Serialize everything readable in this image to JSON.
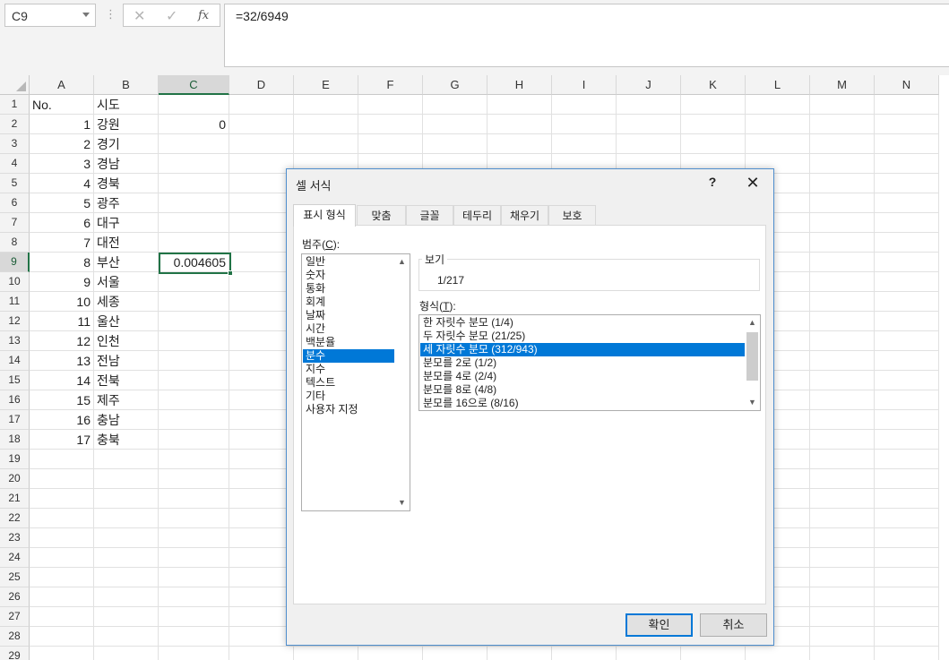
{
  "formula_bar": {
    "name_box": "C9",
    "formula": "=32/6949",
    "cancel_icon": "x-icon",
    "enter_icon": "check-icon",
    "function_icon": "fx-icon",
    "fx_label": "fx"
  },
  "columns": [
    "A",
    "B",
    "C",
    "D",
    "E",
    "F",
    "G",
    "H",
    "I",
    "J",
    "K",
    "L",
    "M",
    "N"
  ],
  "selected_column": "C",
  "rows": [
    "1",
    "2",
    "3",
    "4",
    "5",
    "6",
    "7",
    "8",
    "9",
    "10",
    "11",
    "12",
    "13",
    "14",
    "15",
    "16",
    "17",
    "18",
    "19",
    "20",
    "21",
    "22",
    "23",
    "24",
    "25",
    "26",
    "27",
    "28",
    "29"
  ],
  "selected_row": "9",
  "cells": {
    "A1": "No.",
    "B1": "시도",
    "A2": "1",
    "B2": "강원",
    "C2": "0",
    "A3": "2",
    "B3": "경기",
    "A4": "3",
    "B4": "경남",
    "A5": "4",
    "B5": "경북",
    "A6": "5",
    "B6": "광주",
    "A7": "6",
    "B7": "대구",
    "A8": "7",
    "B8": "대전",
    "A9": "8",
    "B9": "부산",
    "C9": "0.004605",
    "A10": "9",
    "B10": "서울",
    "A11": "10",
    "B11": "세종",
    "A12": "11",
    "B12": "울산",
    "A13": "12",
    "B13": "인천",
    "A14": "13",
    "B14": "전남",
    "A15": "14",
    "B15": "전북",
    "A16": "15",
    "B16": "제주",
    "A17": "16",
    "B17": "충남",
    "A18": "17",
    "B18": "충북"
  },
  "dialog": {
    "title": "셀 서식",
    "help": "?",
    "close": "✕",
    "tabs": [
      "표시 형식",
      "맞춤",
      "글꼴",
      "테두리",
      "채우기",
      "보호"
    ],
    "active_tab": "표시 형식",
    "category_label": "범주(",
    "category_key": "C",
    "category_label_end": "):",
    "categories": [
      "일반",
      "숫자",
      "통화",
      "회계",
      "날짜",
      "시간",
      "백분율",
      "분수",
      "지수",
      "텍스트",
      "기타",
      "사용자 지정"
    ],
    "selected_category": "분수",
    "sample_label": "보기",
    "sample_value": "1/217",
    "type_label": "형식(",
    "type_key": "T",
    "type_label_end": "):",
    "types": [
      "한 자릿수 분모 (1/4)",
      "두 자릿수 분모 (21/25)",
      "세 자릿수 분모 (312/943)",
      "분모를 2로 (1/2)",
      "분모를 4로 (2/4)",
      "분모를 8로 (4/8)",
      "분모를 16으로 (8/16)"
    ],
    "selected_type": "세 자릿수 분모 (312/943)",
    "ok_label": "확인",
    "cancel_label": "취소"
  },
  "colors": {
    "accent_green": "#217346",
    "selection_blue": "#0078d7",
    "dialog_border": "#4f8ecd"
  }
}
